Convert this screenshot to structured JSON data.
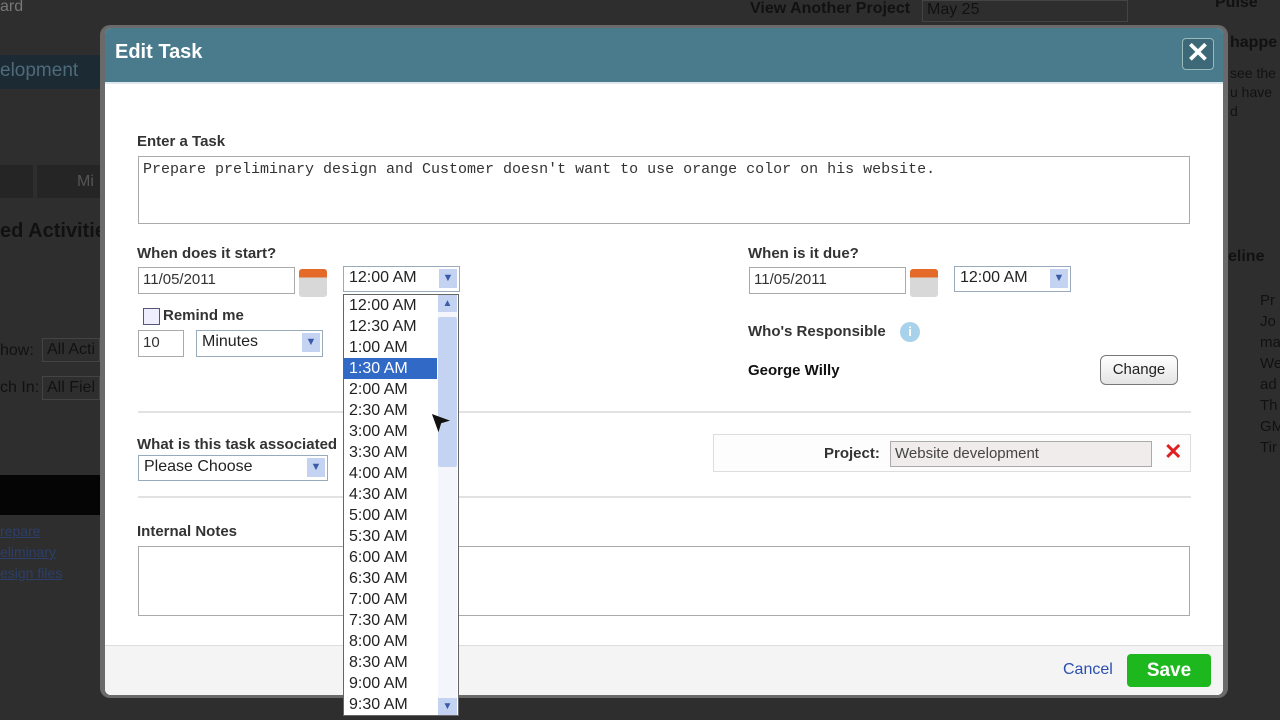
{
  "background": {
    "left": [
      "ard",
      "elopment",
      "Mi",
      "ed Activitie",
      "how:",
      "All Acti",
      "ch In:",
      "All Fiel",
      "repare",
      "eliminary",
      "esign files"
    ],
    "right": [
      "View Another Project",
      "May 25",
      "Pulse",
      "happe",
      "see the",
      "u have",
      "d",
      "eline",
      "Pr",
      "Jo",
      "ma",
      "We",
      "ad",
      "Th",
      "GM",
      "Tir"
    ]
  },
  "dialog": {
    "title": "Edit Task",
    "close_icon": "close-icon",
    "task_label": "Enter a Task",
    "task_value": "Prepare preliminary design and Customer doesn't want to use orange color on his website.",
    "start_label": "When does it start?",
    "start_date": "11/05/2011",
    "start_time": "12:00 AM",
    "remind_label": "Remind me",
    "remind_value": "10",
    "remind_unit": "Minutes",
    "due_label": "When is it due?",
    "due_date": "11/05/2011",
    "due_time": "12:00 AM",
    "responsible_label": "Who's Responsible",
    "responsible_name": "George Willy",
    "change_label": "Change",
    "assoc_label": "What is this task associated",
    "assoc_value": "Please Choose",
    "project_label": "Project:",
    "project_value": "Website development",
    "notes_label": "Internal Notes",
    "cancel_label": "Cancel",
    "save_label": "Save"
  },
  "time_options": [
    "12:00 AM",
    "12:30 AM",
    "1:00 AM",
    "1:30 AM",
    "2:00 AM",
    "2:30 AM",
    "3:00 AM",
    "3:30 AM",
    "4:00 AM",
    "4:30 AM",
    "5:00 AM",
    "5:30 AM",
    "6:00 AM",
    "6:30 AM",
    "7:00 AM",
    "7:30 AM",
    "8:00 AM",
    "8:30 AM",
    "9:00 AM",
    "9:30 AM"
  ],
  "time_highlighted": "1:30 AM",
  "colors": {
    "header": "#4a7b8d",
    "save": "#1db81d",
    "highlight": "#3169c6",
    "remove": "#e02020"
  }
}
